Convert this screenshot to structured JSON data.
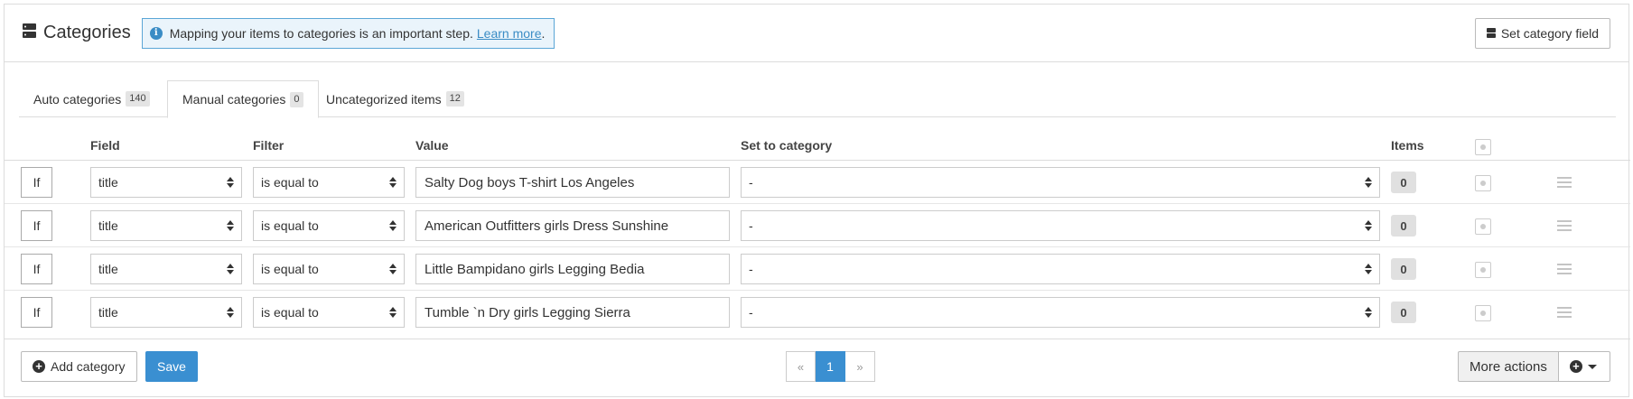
{
  "header": {
    "title": "Categories",
    "alert_text": "Mapping your items to categories is an important step.",
    "alert_link": "Learn more",
    "alert_period": ".",
    "set_category_button": "Set category field"
  },
  "tabs": [
    {
      "label": "Auto categories",
      "count": "140"
    },
    {
      "label": "Manual categories",
      "count": "0"
    },
    {
      "label": "Uncategorized items",
      "count": "12"
    }
  ],
  "table": {
    "columns": {
      "field": "Field",
      "filter": "Filter",
      "value": "Value",
      "set_to_category": "Set to category",
      "items": "Items"
    },
    "rows": [
      {
        "if_label": "If",
        "field": "title",
        "filter": "is equal to",
        "value": "Salty Dog boys T-shirt Los Angeles",
        "category": "-",
        "items": "0"
      },
      {
        "if_label": "If",
        "field": "title",
        "filter": "is equal to",
        "value": "American Outfitters girls Dress Sunshine",
        "category": "-",
        "items": "0"
      },
      {
        "if_label": "If",
        "field": "title",
        "filter": "is equal to",
        "value": "Little Bampidano girls Legging Bedia",
        "category": "-",
        "items": "0"
      },
      {
        "if_label": "If",
        "field": "title",
        "filter": "is equal to",
        "value": "Tumble `n Dry girls Legging Sierra",
        "category": "-",
        "items": "0"
      }
    ]
  },
  "footer": {
    "add_category": "Add category",
    "save": "Save",
    "pager": {
      "prev": "«",
      "current": "1",
      "next": "»"
    },
    "more_actions": "More actions"
  },
  "colors": {
    "primary": "#3a8fd1",
    "alert_bg": "#eaf4fb",
    "alert_border": "#5ba6d6"
  }
}
